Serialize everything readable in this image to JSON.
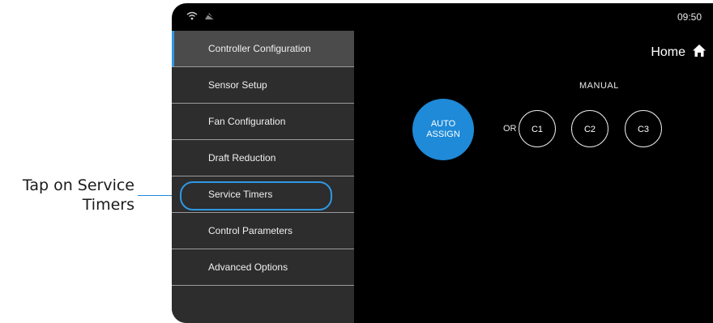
{
  "callout": {
    "line1": "Tap on Service",
    "line2": "Timers"
  },
  "status_bar": {
    "time": "09:50",
    "icons": [
      "wifi-icon",
      "muted-icon"
    ]
  },
  "sidebar": {
    "items": [
      {
        "label": "Controller Configuration",
        "active": true
      },
      {
        "label": "Sensor Setup"
      },
      {
        "label": "Fan Configuration"
      },
      {
        "label": "Draft Reduction"
      },
      {
        "label": "Service Timers",
        "highlighted": true
      },
      {
        "label": "Control Parameters"
      },
      {
        "label": "Advanced Options"
      }
    ]
  },
  "main": {
    "home_label": "Home",
    "manual_label": "MANUAL",
    "auto_assign_line1": "AUTO",
    "auto_assign_line2": "ASSIGN",
    "or_label": "OR",
    "channels": [
      "C1",
      "C2",
      "C3"
    ]
  },
  "colors": {
    "accent": "#1e8ad8",
    "sidebar_bg": "#2d2d2d",
    "active_item_bg": "#4b4b4b",
    "screen_bg": "#000000"
  }
}
